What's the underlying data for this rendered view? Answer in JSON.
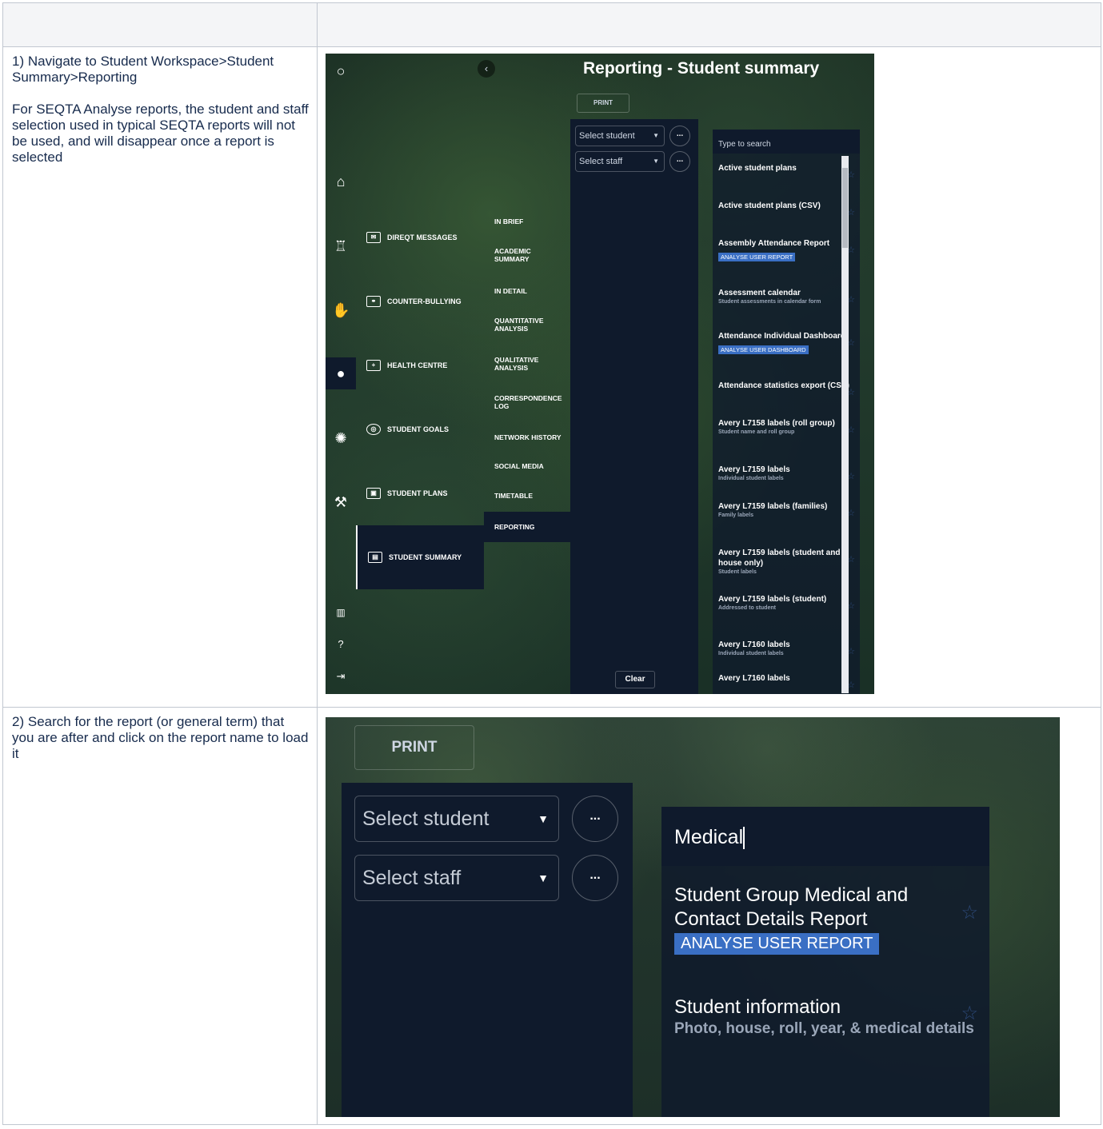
{
  "steps": [
    {
      "number": "1)",
      "lines": [
        "Navigate to Student Workspace>Student Summary>Reporting",
        "For SEQTA Analyse reports, the student and staff selection used in typical SEQTA reports will not be used, and will disappear once a report is selected"
      ]
    },
    {
      "number": "2)",
      "lines": [
        "Search for the report (or general term) that you are after and click on the report name to load it"
      ]
    }
  ],
  "shot1": {
    "title": "Reporting - Student summary",
    "print_label": "PRINT",
    "select_student": "Select student",
    "select_staff": "Select staff",
    "dots": "...",
    "clear_label": "Clear",
    "search_placeholder": "Type to search",
    "rail_icons": [
      "search-icon",
      "home-icon",
      "classroom-icon",
      "hand-icon",
      "person-icon",
      "sun-icon",
      "wrench-icon",
      "chart-icon",
      "help-icon",
      "logout-icon"
    ],
    "nav_groups": [
      "DIREQT MESSAGES",
      "COUNTER-BULLYING",
      "HEALTH CENTRE",
      "STUDENT GOALS",
      "STUDENT PLANS",
      "STUDENT SUMMARY"
    ],
    "sub_items": [
      "IN BRIEF",
      "ACADEMIC SUMMARY",
      "IN DETAIL",
      "QUANTITATIVE ANALYSIS",
      "QUALITATIVE ANALYSIS",
      "CORRESPONDENCE LOG",
      "NETWORK HISTORY",
      "SOCIAL MEDIA",
      "TIMETABLE",
      "REPORTING"
    ],
    "reports": [
      {
        "name": "Active student plans",
        "sub": "",
        "badge": ""
      },
      {
        "name": "Active student plans (CSV)",
        "sub": "",
        "badge": ""
      },
      {
        "name": "Assembly Attendance Report",
        "sub": "",
        "badge": "ANALYSE USER REPORT"
      },
      {
        "name": "Assessment calendar",
        "sub": "Student assessments in calendar form",
        "badge": ""
      },
      {
        "name": "Attendance Individual Dashboard",
        "sub": "",
        "badge": "ANALYSE USER DASHBOARD"
      },
      {
        "name": "Attendance statistics export (CSV)",
        "sub": "",
        "badge": ""
      },
      {
        "name": "Avery L7158 labels (roll group)",
        "sub": "Student name and roll group",
        "badge": ""
      },
      {
        "name": "Avery L7159 labels",
        "sub": "Individual student labels",
        "badge": ""
      },
      {
        "name": "Avery L7159 labels (families)",
        "sub": "Family labels",
        "badge": ""
      },
      {
        "name": "Avery L7159 labels (student and house only)",
        "sub": "Student labels",
        "badge": ""
      },
      {
        "name": "Avery L7159 labels (student)",
        "sub": "Addressed to student",
        "badge": ""
      },
      {
        "name": "Avery L7160 labels",
        "sub": "Individual student labels",
        "badge": ""
      },
      {
        "name": "Avery L7160 labels",
        "sub": "",
        "badge": ""
      }
    ]
  },
  "shot2": {
    "print_label": "PRINT",
    "select_student": "Select student",
    "select_staff": "Select staff",
    "dots": "...",
    "search_value": "Medical",
    "results": [
      {
        "name": "Student Group Medical and Contact Details Report",
        "badge": "ANALYSE USER REPORT",
        "sub": ""
      },
      {
        "name": "Student information",
        "badge": "",
        "sub": "Photo, house, roll, year, & medical details"
      }
    ]
  }
}
